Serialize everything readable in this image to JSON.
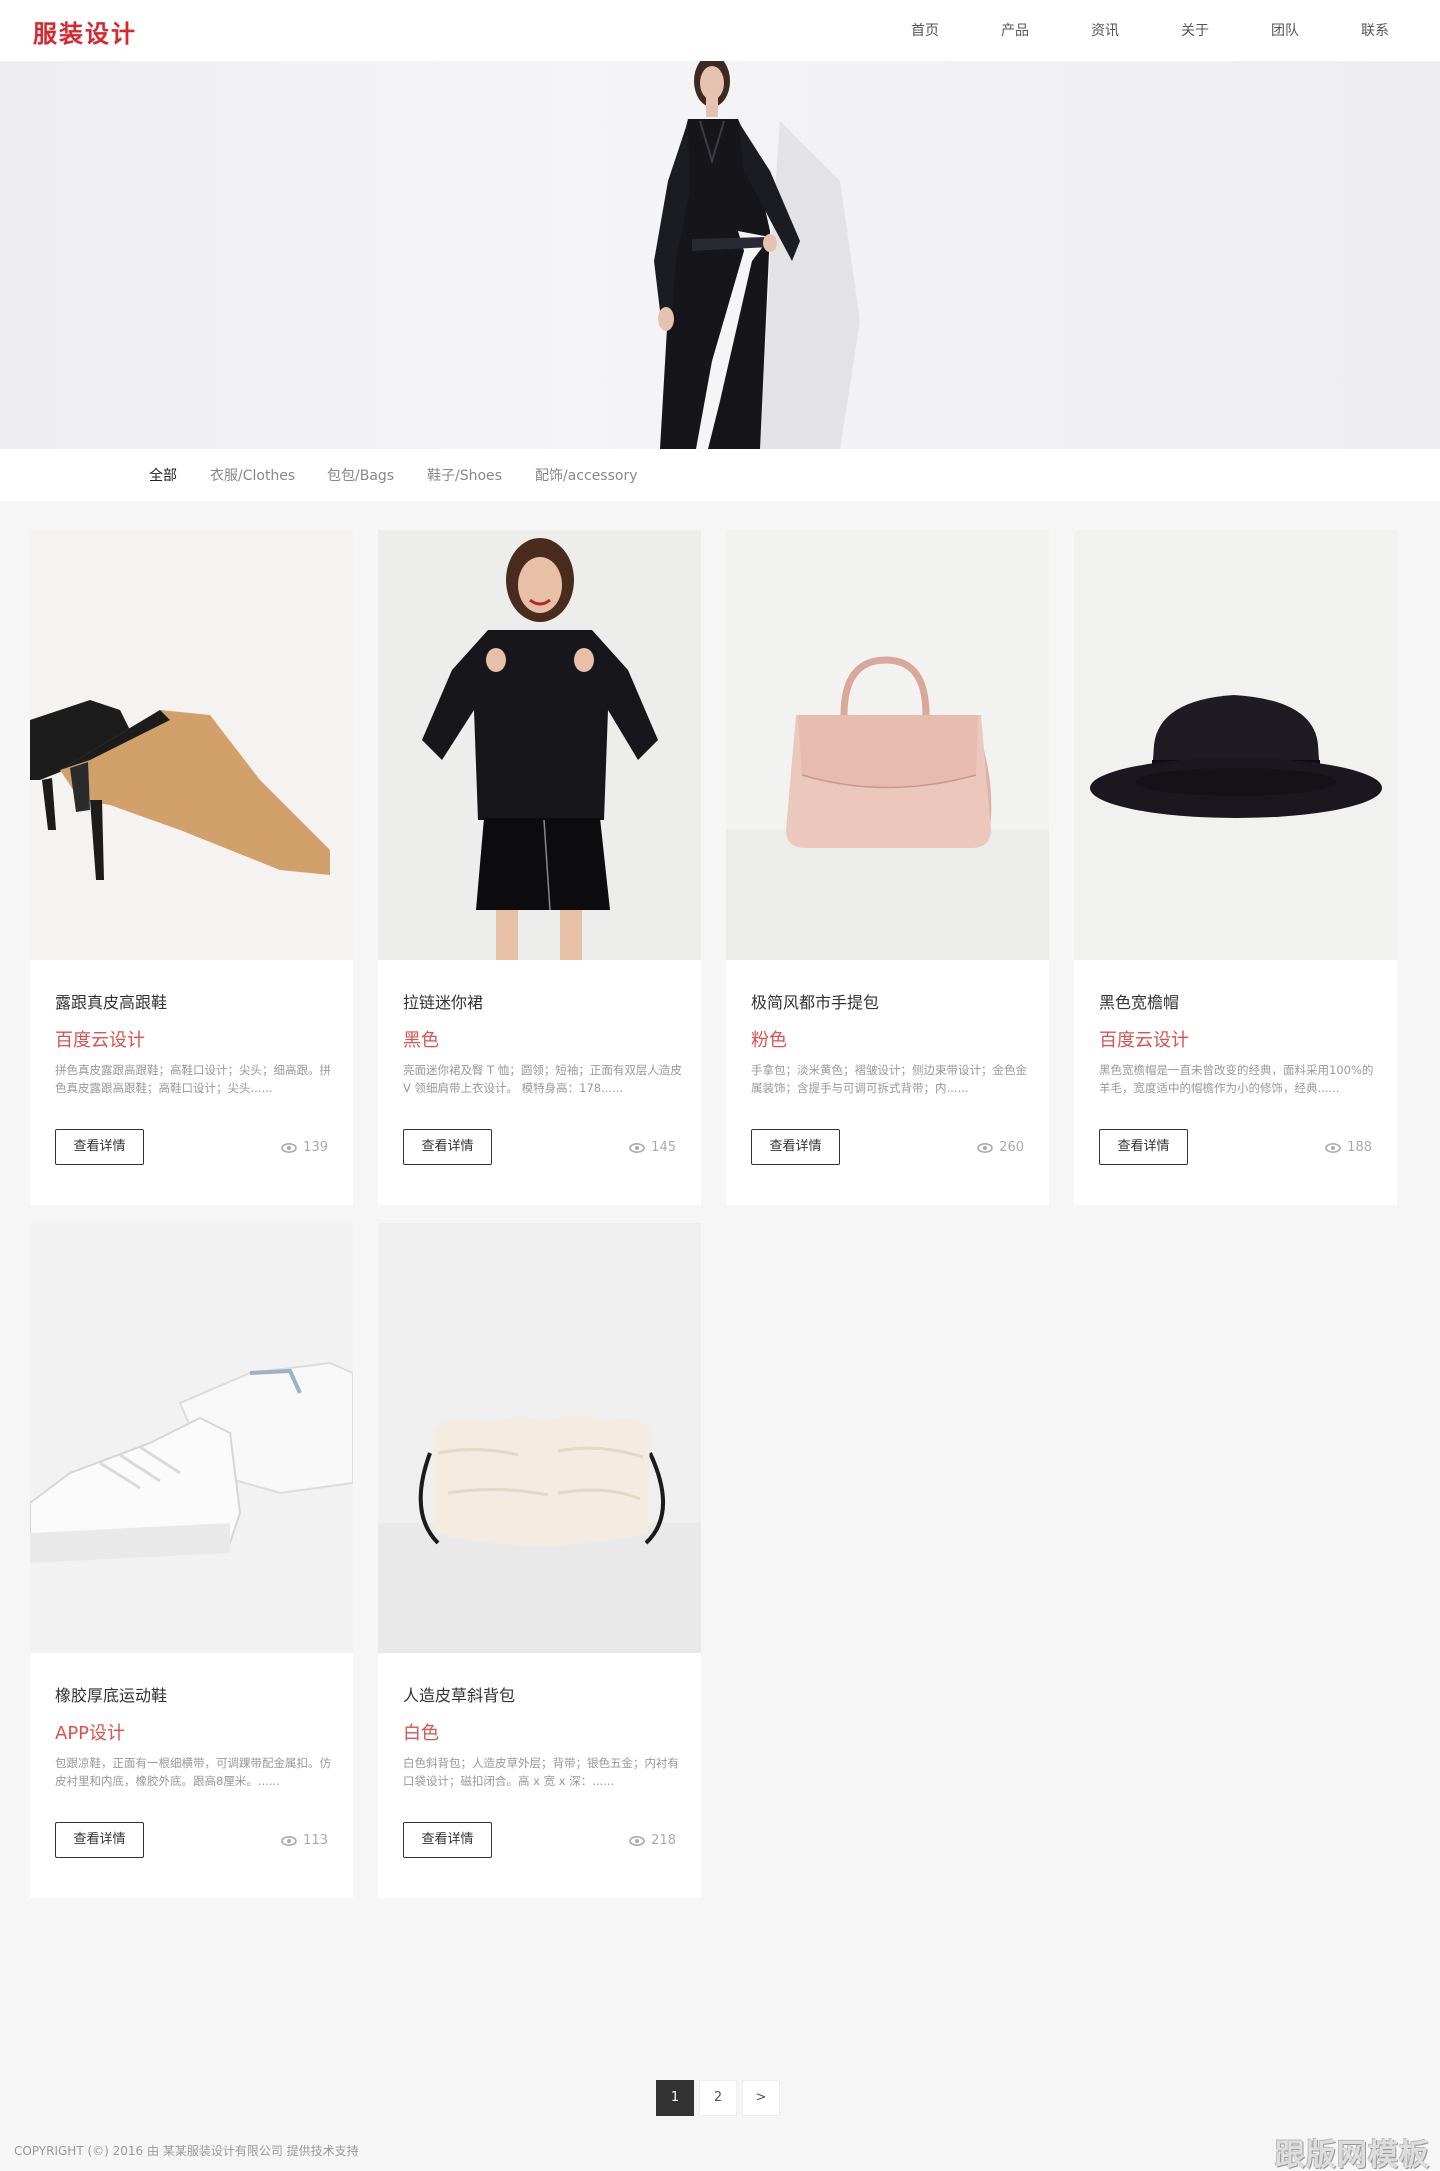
{
  "header": {
    "logo": "服装设计",
    "nav": [
      "首页",
      "产品",
      "资讯",
      "关于",
      "团队",
      "联系"
    ]
  },
  "filters": [
    "全部",
    "衣服/Clothes",
    "包包/Bags",
    "鞋子/Shoes",
    "配饰/accessory"
  ],
  "products": [
    {
      "title": "露跟真皮高跟鞋",
      "tag": "百度云设计",
      "desc": "拼色真皮露跟高跟鞋；高鞋口设计；尖头；细高跟。拼色真皮露跟高跟鞋；高鞋口设计；尖头......",
      "button": "查看详情",
      "views": "139",
      "image": "camel-mule-heels"
    },
    {
      "title": "拉链迷你裙",
      "tag": "黑色",
      "desc": "亮面迷你裙及臀 T 恤；圆领；短袖；正面有双层人造皮 V 领细肩带上衣设计。 模特身高：178......",
      "button": "查看详情",
      "views": "145",
      "image": "model-black-outfit"
    },
    {
      "title": "极简风都市手提包",
      "tag": "粉色",
      "desc": "手拿包；淡米黄色；褶皱设计；侧边束带设计；金色金属装饰；含提手与可调可拆式背带；内......",
      "button": "查看详情",
      "views": "260",
      "image": "pink-handbag"
    },
    {
      "title": "黑色宽檐帽",
      "tag": "百度云设计",
      "desc": "黑色宽檐帽是一直未曾改变的经典，面料采用100%的羊毛，宽度适中的帽檐作为小的修饰，经典......",
      "button": "查看详情",
      "views": "188",
      "image": "black-hat"
    },
    {
      "title": "橡胶厚底运动鞋",
      "tag": "APP设计",
      "desc": "包跟凉鞋，正面有一根细横带，可调踝带配金属扣。仿皮衬里和内底，橡胶外底。跟高8厘米。......",
      "button": "查看详情",
      "views": "113",
      "image": "white-sneakers"
    },
    {
      "title": "人造皮草斜背包",
      "tag": "白色",
      "desc": "白色斜背包；人造皮草外层；背带；银色五金；内衬有口袋设计；磁扣闭合。高 x 宽 x 深：......",
      "button": "查看详情",
      "views": "218",
      "image": "fur-crossbody-bag"
    }
  ],
  "pagination": [
    "1",
    "2",
    ">"
  ],
  "pagination_active": "1",
  "footer": "COPYRIGHT (©) 2016 由 某某服装设计有限公司 提供技术支持",
  "watermark": "跟版网模板",
  "colors": {
    "accent": "#d9272e",
    "tag": "#d9534f",
    "background": "#f6f6f6"
  }
}
